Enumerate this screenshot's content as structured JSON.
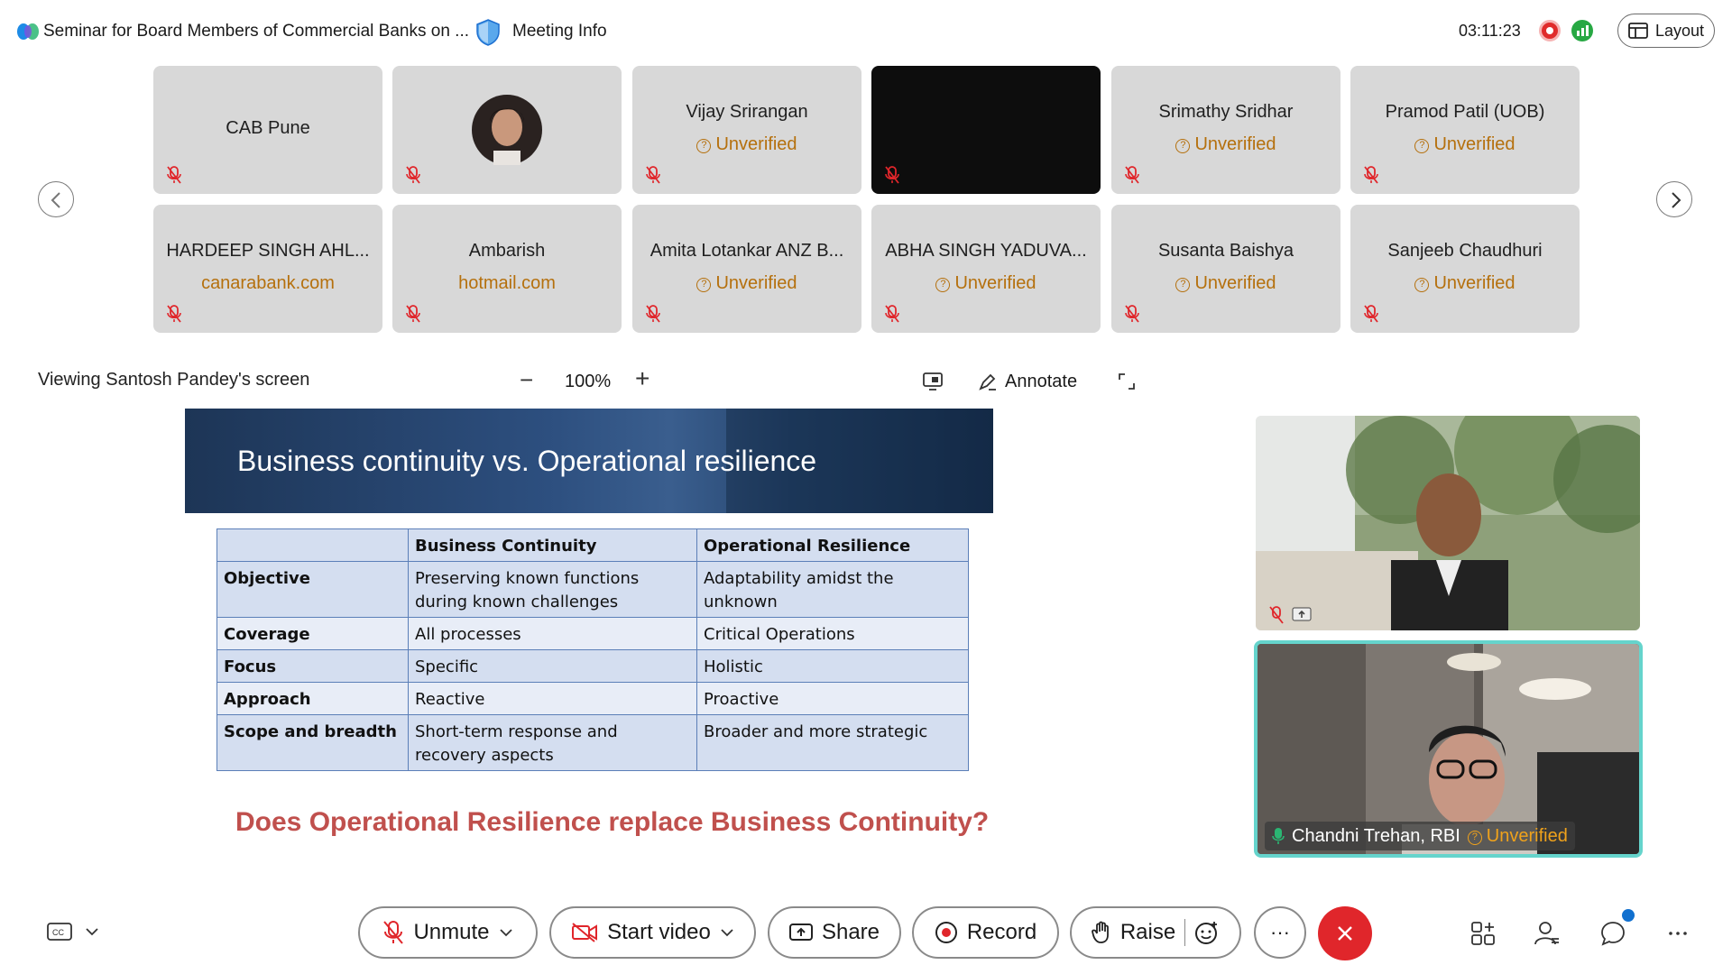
{
  "topbar": {
    "meeting_title": "Seminar for Board Members of Commercial Banks on ...",
    "meeting_info": "Meeting Info",
    "timer": "03:11:23",
    "layout_label": "Layout"
  },
  "participants": [
    {
      "name": "CAB Pune",
      "sub": ""
    },
    {
      "name": "",
      "sub": "",
      "avatar": true
    },
    {
      "name": "Vijay Srirangan",
      "sub": "Unverified"
    },
    {
      "name": "",
      "sub": "",
      "dark": true
    },
    {
      "name": "Srimathy Sridhar",
      "sub": "Unverified"
    },
    {
      "name": "Pramod Patil (UOB)",
      "sub": "Unverified"
    },
    {
      "name": "HARDEEP SINGH AHL...",
      "sub": "canarabank.com"
    },
    {
      "name": "Ambarish",
      "sub": "hotmail.com"
    },
    {
      "name": "Amita Lotankar ANZ B...",
      "sub": "Unverified"
    },
    {
      "name": "ABHA SINGH YADUVA...",
      "sub": "Unverified"
    },
    {
      "name": "Susanta Baishya",
      "sub": "Unverified"
    },
    {
      "name": "Sanjeeb Chaudhuri",
      "sub": "Unverified"
    }
  ],
  "share": {
    "viewing": "Viewing Santosh Pandey's screen",
    "zoom": "100%",
    "minus": "−",
    "plus": "+",
    "annotate": "Annotate"
  },
  "slide": {
    "title": "Business continuity vs. Operational resilience",
    "headers": [
      "",
      "Business Continuity",
      "Operational Resilience"
    ],
    "rows": [
      [
        "Objective",
        "Preserving known functions during known challenges",
        "Adaptability amidst the unknown"
      ],
      [
        "Coverage",
        "All processes",
        "Critical Operations"
      ],
      [
        "Focus",
        "Specific",
        "Holistic"
      ],
      [
        "Approach",
        "Reactive",
        "Proactive"
      ],
      [
        "Scope and breadth",
        "Short-term response and recovery aspects",
        "Broader and more strategic"
      ]
    ],
    "question": "Does Operational Resilience replace Business Continuity?"
  },
  "videos": {
    "speaker_name": "Chandni Trehan, RBI",
    "speaker_status": "Unverified"
  },
  "toolbar": {
    "unmute": "Unmute",
    "start_video": "Start video",
    "share": "Share",
    "record": "Record",
    "raise": "Raise",
    "more": "···"
  },
  "colors": {
    "unverified": "#b5700d",
    "end_call": "#e0262b",
    "active_speaker_border": "#65d4cc",
    "slide_question": "#c0504d"
  }
}
